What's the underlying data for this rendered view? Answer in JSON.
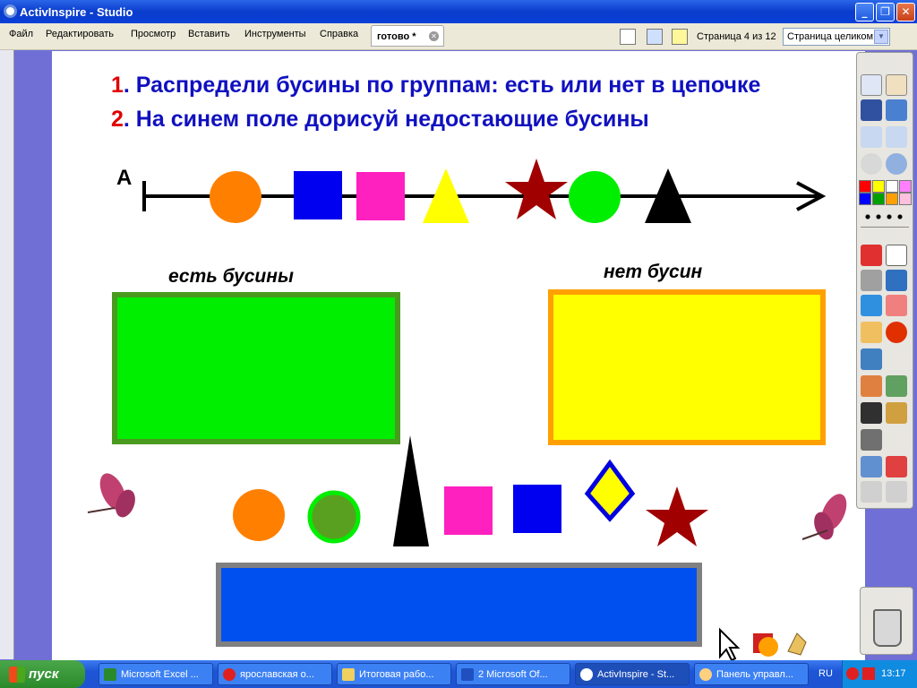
{
  "window": {
    "title": "ActivInspire - Studio"
  },
  "menu": [
    "Файл",
    "Редактировать",
    "Просмотр",
    "Вставить",
    "Инструменты",
    "Справка"
  ],
  "doc_tab": {
    "label": "готово *"
  },
  "toolbar": {
    "page_info": "Страница 4 из 12",
    "zoom_value": "Страница целиком"
  },
  "flipchart": {
    "task1_num": "1",
    "task1_text": ". Распредели бусины по группам: есть или нет в цепочке",
    "task2_num": "2",
    "task2_text": ". На синем поле дорисуй недостающие бусины",
    "axis_label": "A",
    "group_yes": "есть бусины",
    "group_no": "нет бусин",
    "colors": {
      "task_num": "#e00000",
      "task_text": "#1010c0",
      "green_box": "#00e000",
      "yellow_box": "#ffff00",
      "blue_box": "#0050f0"
    }
  },
  "taskbar": {
    "start": "пуск",
    "tasks": [
      {
        "label": "Microsoft Excel ...",
        "icon": "excel-icon"
      },
      {
        "label": "ярославская о...",
        "icon": "opera-icon"
      },
      {
        "label": "Итоговая рабо...",
        "icon": "folder-icon"
      },
      {
        "label": "2 Microsoft Of...",
        "icon": "word-icon"
      },
      {
        "label": "ActivInspire - St...",
        "icon": "activinspire-icon"
      },
      {
        "label": "Панель управл...",
        "icon": "control-panel-icon"
      }
    ],
    "lang": "RU",
    "clock": "13:17"
  }
}
